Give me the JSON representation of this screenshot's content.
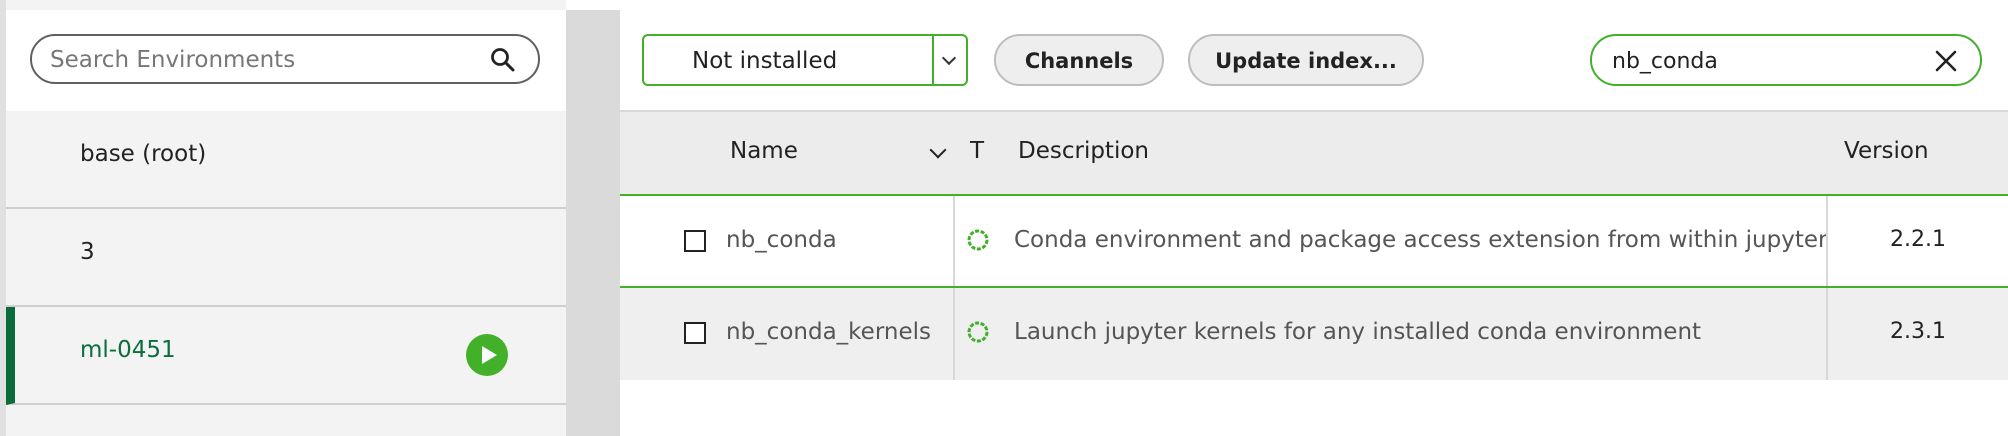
{
  "environments": {
    "search": {
      "placeholder": "Search Environments",
      "icon": "search-icon"
    },
    "items": [
      {
        "label": "base (root)",
        "active": false
      },
      {
        "label": "3",
        "active": false
      },
      {
        "label": "ml-0451",
        "active": true,
        "action_icon": "play-icon"
      }
    ]
  },
  "toolbar": {
    "filter_value": "Not installed",
    "channels_label": "Channels",
    "update_label": "Update index...",
    "search_value": "nb_conda",
    "clear_icon": "close-icon"
  },
  "table": {
    "headers": {
      "name": "Name",
      "type": "T",
      "description": "Description",
      "version": "Version"
    },
    "rows": [
      {
        "name": "nb_conda",
        "type_icon": "conda-package-icon",
        "description": "Conda environment and package access extension from within jupyter",
        "version": "2.2.1"
      },
      {
        "name": "nb_conda_kernels",
        "type_icon": "conda-package-icon",
        "description": "Launch jupyter kernels for any installed conda environment",
        "version": "2.3.1"
      }
    ]
  },
  "colors": {
    "accent_green": "#43b02a",
    "active_env": "#0b6e3c"
  }
}
